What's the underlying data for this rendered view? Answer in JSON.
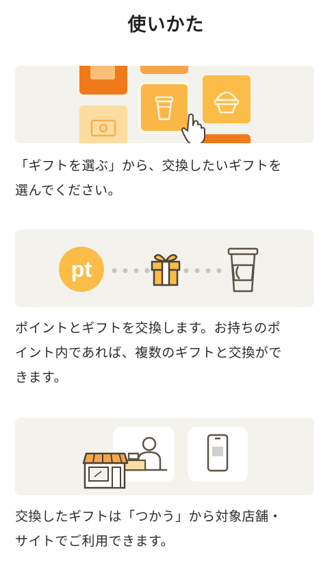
{
  "page": {
    "title": "使いかた"
  },
  "steps": [
    {
      "illustration": "gift-selection-tiles-with-pointer",
      "line1": "「ギフトを選ぶ」から、交換したいギフトを",
      "line2": "選んでください。"
    },
    {
      "illustration": "points-to-gift-to-coffee",
      "badge_text": "pt",
      "line1": "ポイントとギフトを交換します。お持ちのポ",
      "line2": "イント内であれば、複数のギフトと交換がで",
      "line3": "きます。"
    },
    {
      "illustration": "shop-and-phone-usage",
      "line1": "交換したギフトは「つかう」から対象店舗・",
      "line2": "サイトでご利用できます。"
    }
  ],
  "colors": {
    "card_bg": "#f3f2ec",
    "orange_dark": "#f07a1a",
    "orange_mid": "#f5a64a",
    "orange_light": "#fbd38c",
    "yellow": "#fbbd48",
    "icon_stroke": "#5b5346"
  }
}
